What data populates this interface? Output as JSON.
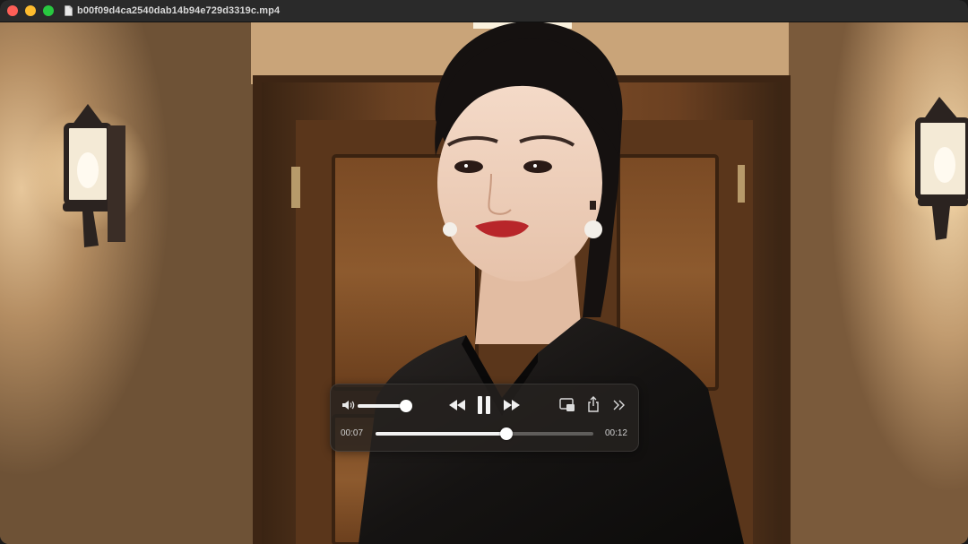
{
  "window": {
    "title": "b00f09d4ca2540dab14b94e729d3319c.mp4"
  },
  "player": {
    "current_time": "00:07",
    "duration": "00:12",
    "progress_fraction": 0.6,
    "volume_fraction": 1.0,
    "state": "playing"
  },
  "icons": {
    "file": "document-icon",
    "volume": "speaker-icon",
    "rewind": "rewind-icon",
    "pause": "pause-icon",
    "fast_forward": "fast-forward-icon",
    "pip": "picture-in-picture-icon",
    "share": "share-icon",
    "more": "chevron-double-right-icon"
  },
  "colors": {
    "close": "#ff5f57",
    "minimize": "#febc2e",
    "maximize": "#28c840"
  }
}
